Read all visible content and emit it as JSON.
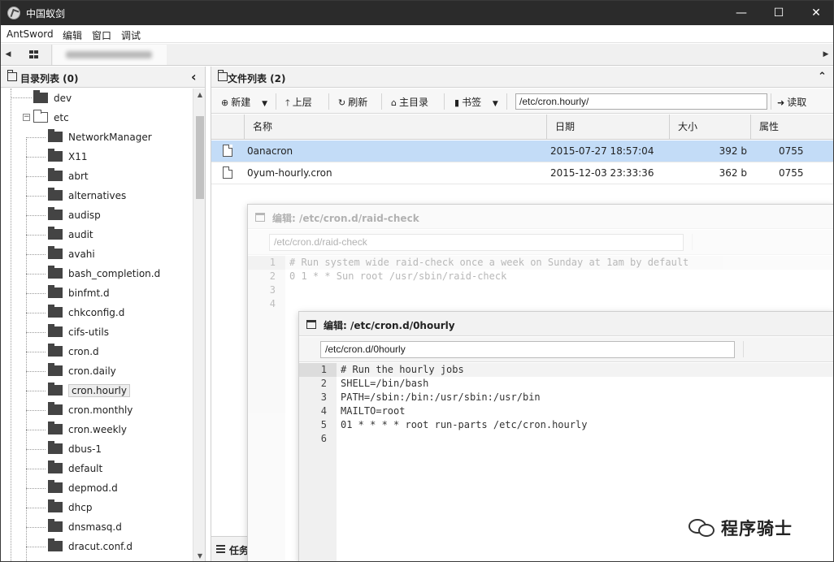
{
  "window": {
    "title": "中国蚁剑"
  },
  "titlebar": {
    "minimize": "—",
    "maximize": "☐",
    "close": "✕"
  },
  "menubar": [
    "AntSword",
    "编辑",
    "窗口",
    "调试"
  ],
  "tabs": {
    "left_arrow": "◀",
    "right_arrow": "▶"
  },
  "dir_panel": {
    "title": "目录列表 (0)",
    "collapse": "‹",
    "tree": [
      {
        "label": "dev",
        "level": 1
      },
      {
        "label": "etc",
        "level": 1,
        "expanded": true
      },
      {
        "label": "NetworkManager",
        "level": 2
      },
      {
        "label": "X11",
        "level": 2
      },
      {
        "label": "abrt",
        "level": 2
      },
      {
        "label": "alternatives",
        "level": 2
      },
      {
        "label": "audisp",
        "level": 2
      },
      {
        "label": "audit",
        "level": 2
      },
      {
        "label": "avahi",
        "level": 2
      },
      {
        "label": "bash_completion.d",
        "level": 2
      },
      {
        "label": "binfmt.d",
        "level": 2
      },
      {
        "label": "chkconfig.d",
        "level": 2
      },
      {
        "label": "cifs-utils",
        "level": 2
      },
      {
        "label": "cron.d",
        "level": 2
      },
      {
        "label": "cron.daily",
        "level": 2
      },
      {
        "label": "cron.hourly",
        "level": 2,
        "selected": true
      },
      {
        "label": "cron.monthly",
        "level": 2
      },
      {
        "label": "cron.weekly",
        "level": 2
      },
      {
        "label": "dbus-1",
        "level": 2
      },
      {
        "label": "default",
        "level": 2
      },
      {
        "label": "depmod.d",
        "level": 2
      },
      {
        "label": "dhcp",
        "level": 2
      },
      {
        "label": "dnsmasq.d",
        "level": 2
      },
      {
        "label": "dracut.conf.d",
        "level": 2
      }
    ]
  },
  "file_panel": {
    "title": "文件列表 (2)",
    "collapse": "⌃",
    "toolbar": {
      "new": "新建",
      "up": "上层",
      "refresh": "刷新",
      "home": "主目录",
      "bookmark": "书签",
      "path": "/etc/cron.hourly/",
      "read": "读取"
    },
    "columns": [
      "名称",
      "日期",
      "大小",
      "属性"
    ],
    "files": [
      {
        "name": "0anacron",
        "date": "2015-07-27 18:57:04",
        "size": "392 b",
        "attr": "0755",
        "selected": true
      },
      {
        "name": "0yum-hourly.cron",
        "date": "2015-12-03 23:33:36",
        "size": "362 b",
        "attr": "0755",
        "selected": false
      }
    ],
    "task_label": "任务"
  },
  "editor_back": {
    "title": "编辑: /etc/cron.d/raid-check",
    "path": "/etc/cron.d/raid-check",
    "lines": [
      {
        "n": "1",
        "text": "# Run system wide raid-check once a week on Sunday at 1am by default"
      },
      {
        "n": "2",
        "text": "0 1 * * Sun root /usr/sbin/raid-check"
      },
      {
        "n": "3",
        "text": ""
      },
      {
        "n": "4",
        "text": ""
      }
    ]
  },
  "editor_front": {
    "title": "编辑: /etc/cron.d/0hourly",
    "path": "/etc/cron.d/0hourly",
    "lines": [
      {
        "n": "1",
        "text": "# Run the hourly jobs"
      },
      {
        "n": "2",
        "text": "SHELL=/bin/bash"
      },
      {
        "n": "3",
        "text": "PATH=/sbin:/bin:/usr/sbin:/usr/bin"
      },
      {
        "n": "4",
        "text": "MAILTO=root"
      },
      {
        "n": "5",
        "text": "01 * * * * root run-parts /etc/cron.hourly"
      },
      {
        "n": "6",
        "text": ""
      }
    ]
  },
  "watermark": {
    "text": "程序骑士"
  }
}
